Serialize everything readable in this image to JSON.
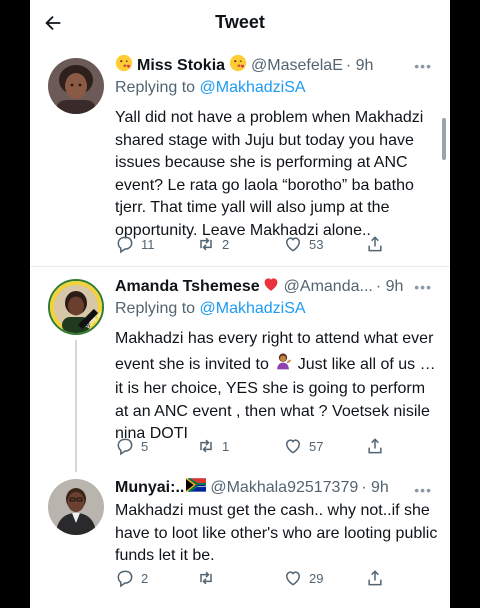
{
  "header": {
    "title": "Tweet"
  },
  "tweets": [
    {
      "name": "Miss Stokia",
      "handle": "@MasefelaE",
      "time": "· 9h",
      "reply_prefix": "Replying to",
      "reply_to": "@MakhadziSA",
      "text": "Yall did not have a problem when Makhadzi shared stage with Juju but today you have issues because she is performing at ANC event? Le rata go laola “borotho” ba batho tjerr. That time yall will also jump at the opportunity. Leave Makhadzi alone..",
      "replies": "11",
      "retweets": "2",
      "likes": "53"
    },
    {
      "name": "Amanda Tshemese",
      "handle": "@Amanda...",
      "time": "· 9h",
      "reply_prefix": "Replying to",
      "reply_to": "@MakhadziSA",
      "text_before": "Makhadzi has every right to attend what ever event she is invited to",
      "text_after": "Just like all of us … it is her choice, YES she is going to perform at an ANC event , then what ? Voetsek nisile nina DOTI",
      "avatar_text": "VOTE ANC",
      "replies": "5",
      "retweets": "1",
      "likes": "57"
    },
    {
      "name": "Munyai:..",
      "handle": "@Makhala92517379",
      "time": "· 9h",
      "text": "Makhadzi must get the cash.. why not..if she have to loot like other's who are looting public funds let it be.",
      "replies": "2",
      "retweets": "",
      "likes": "29"
    }
  ],
  "icons": {
    "back": "back-arrow-icon",
    "more": "more-icon",
    "reply": "reply-icon",
    "retweet": "retweet-icon",
    "like": "heart-icon",
    "share": "share-icon"
  },
  "colors": {
    "link": "#1d9bf0",
    "secondary": "#536471",
    "text": "#0f1419"
  }
}
